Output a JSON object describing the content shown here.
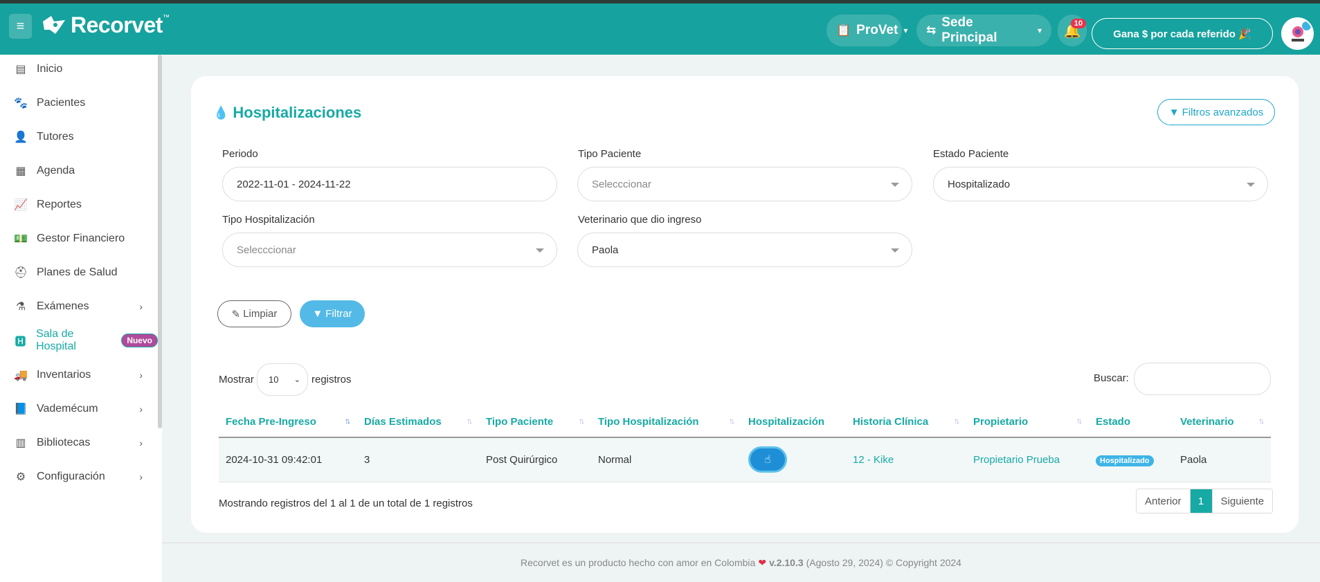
{
  "header": {
    "brand": "Recorvet",
    "brand_tm": "™",
    "provet_label": "ProVet",
    "sede_label": "Sede Principal",
    "notifications_count": "10",
    "referral_label": "Gana $ por cada referido 🎉",
    "accent_color": "#16a29e"
  },
  "sidebar": {
    "items": [
      {
        "label": "Inicio",
        "icon": "clipboard-icon"
      },
      {
        "label": "Pacientes",
        "icon": "paw-icon"
      },
      {
        "label": "Tutores",
        "icon": "user-icon"
      },
      {
        "label": "Agenda",
        "icon": "calendar-icon"
      },
      {
        "label": "Reportes",
        "icon": "chart-line-icon"
      },
      {
        "label": "Gestor Financiero",
        "icon": "money-icon"
      },
      {
        "label": "Planes de Salud",
        "icon": "medkit-icon"
      },
      {
        "label": "Exámenes",
        "icon": "flask-icon"
      },
      {
        "label": "Sala de Hospital",
        "icon": "hospital-icon",
        "badge": "Nuevo"
      },
      {
        "label": "Inventarios",
        "icon": "truck-icon"
      },
      {
        "label": "Vademécum",
        "icon": "book-icon"
      },
      {
        "label": "Bibliotecas",
        "icon": "library-icon"
      },
      {
        "label": "Configuración",
        "icon": "cogs-icon"
      }
    ]
  },
  "page": {
    "title": "Hospitalizaciones",
    "advanced_filters": "Filtros avanzados"
  },
  "filters": {
    "periodo_label": "Periodo",
    "periodo_value": "2022-11-01 - 2024-11-22",
    "tipo_paciente_label": "Tipo Paciente",
    "tipo_paciente_value": "Selecccionar",
    "estado_paciente_label": "Estado Paciente",
    "estado_paciente_value": "Hospitalizado",
    "tipo_hosp_label": "Tipo Hospitalización",
    "tipo_hosp_value": "Selecccionar",
    "veterinario_label": "Veterinario que dio ingreso",
    "veterinario_value": "Paola",
    "clear_label": "Limpiar",
    "filter_label": "Filtrar"
  },
  "table_controls": {
    "show_label": "Mostrar",
    "page_size": "10",
    "records_label": "registros",
    "search_label": "Buscar:"
  },
  "table": {
    "columns": [
      "Fecha Pre-Ingreso",
      "Días Estimados",
      "Tipo Paciente",
      "Tipo Hospitalización",
      "Hospitalización",
      "Historia Clínica",
      "Propietario",
      "Estado",
      "Veterinario"
    ],
    "rows": [
      {
        "fecha": "2024-10-31 09:42:01",
        "dias": "3",
        "tipo_paciente": "Post Quirúrgico",
        "tipo_hosp": "Normal",
        "historia": "12 - Kike",
        "propietario": "Propietario Prueba",
        "estado": "Hospitalizado",
        "veterinario": "Paola"
      }
    ]
  },
  "pagination": {
    "summary": "Mostrando registros del 1 al 1 de un total de 1 registros",
    "prev": "Anterior",
    "current": "1",
    "next": "Siguiente"
  },
  "footer": {
    "text_before": "Recorvet es un producto hecho con amor en Colombia",
    "version": "v.2.10.3",
    "text_after": "(Agosto 29, 2024) © Copyright 2024"
  }
}
